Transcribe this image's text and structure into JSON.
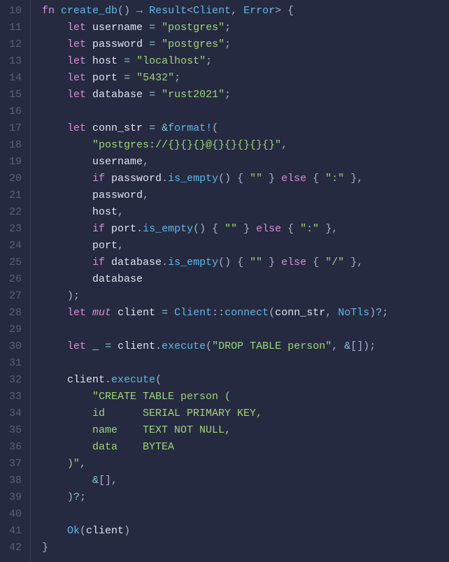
{
  "gutter": {
    "start": 10,
    "end": 42
  },
  "code": {
    "lines": [
      [
        [
          "kw",
          "fn "
        ],
        [
          "fn",
          "create_db"
        ],
        [
          "pun",
          "() "
        ],
        [
          "op",
          "→"
        ],
        [
          "pun",
          " "
        ],
        [
          "ty",
          "Result"
        ],
        [
          "pun",
          "<"
        ],
        [
          "ty",
          "Client"
        ],
        [
          "pun",
          ", "
        ],
        [
          "ty",
          "Error"
        ],
        [
          "pun",
          "> {"
        ]
      ],
      [
        [
          "pun",
          "    "
        ],
        [
          "kw",
          "let"
        ],
        [
          "pun",
          " "
        ],
        [
          "var",
          "username"
        ],
        [
          "pun",
          " "
        ],
        [
          "op",
          "="
        ],
        [
          "pun",
          " "
        ],
        [
          "str",
          "\"postgres\""
        ],
        [
          "pun",
          ";"
        ]
      ],
      [
        [
          "pun",
          "    "
        ],
        [
          "kw",
          "let"
        ],
        [
          "pun",
          " "
        ],
        [
          "var",
          "password"
        ],
        [
          "pun",
          " "
        ],
        [
          "op",
          "="
        ],
        [
          "pun",
          " "
        ],
        [
          "str",
          "\"postgres\""
        ],
        [
          "pun",
          ";"
        ]
      ],
      [
        [
          "pun",
          "    "
        ],
        [
          "kw",
          "let"
        ],
        [
          "pun",
          " "
        ],
        [
          "var",
          "host"
        ],
        [
          "pun",
          " "
        ],
        [
          "op",
          "="
        ],
        [
          "pun",
          " "
        ],
        [
          "str",
          "\"localhost\""
        ],
        [
          "pun",
          ";"
        ]
      ],
      [
        [
          "pun",
          "    "
        ],
        [
          "kw",
          "let"
        ],
        [
          "pun",
          " "
        ],
        [
          "var",
          "port"
        ],
        [
          "pun",
          " "
        ],
        [
          "op",
          "="
        ],
        [
          "pun",
          " "
        ],
        [
          "str",
          "\"5432\""
        ],
        [
          "pun",
          ";"
        ]
      ],
      [
        [
          "pun",
          "    "
        ],
        [
          "kw",
          "let"
        ],
        [
          "pun",
          " "
        ],
        [
          "var",
          "database"
        ],
        [
          "pun",
          " "
        ],
        [
          "op",
          "="
        ],
        [
          "pun",
          " "
        ],
        [
          "str",
          "\"rust2021\""
        ],
        [
          "pun",
          ";"
        ]
      ],
      [],
      [
        [
          "pun",
          "    "
        ],
        [
          "kw",
          "let"
        ],
        [
          "pun",
          " "
        ],
        [
          "var",
          "conn_str"
        ],
        [
          "pun",
          " "
        ],
        [
          "op",
          "="
        ],
        [
          "pun",
          " "
        ],
        [
          "amp",
          "&"
        ],
        [
          "mac",
          "format!"
        ],
        [
          "pun",
          "("
        ]
      ],
      [
        [
          "pun",
          "        "
        ],
        [
          "str",
          "\"postgres://{}{}{}@{}{}{}{}{}\""
        ],
        [
          "pun",
          ","
        ]
      ],
      [
        [
          "pun",
          "        "
        ],
        [
          "var",
          "username"
        ],
        [
          "pun",
          ","
        ]
      ],
      [
        [
          "pun",
          "        "
        ],
        [
          "kw",
          "if"
        ],
        [
          "pun",
          " "
        ],
        [
          "var",
          "password"
        ],
        [
          "pun",
          "."
        ],
        [
          "fn",
          "is_empty"
        ],
        [
          "pun",
          "() { "
        ],
        [
          "str",
          "\"\""
        ],
        [
          "pun",
          " } "
        ],
        [
          "kw",
          "else"
        ],
        [
          "pun",
          " { "
        ],
        [
          "str",
          "\":\""
        ],
        [
          "pun",
          " },"
        ]
      ],
      [
        [
          "pun",
          "        "
        ],
        [
          "var",
          "password"
        ],
        [
          "pun",
          ","
        ]
      ],
      [
        [
          "pun",
          "        "
        ],
        [
          "var",
          "host"
        ],
        [
          "pun",
          ","
        ]
      ],
      [
        [
          "pun",
          "        "
        ],
        [
          "kw",
          "if"
        ],
        [
          "pun",
          " "
        ],
        [
          "var",
          "port"
        ],
        [
          "pun",
          "."
        ],
        [
          "fn",
          "is_empty"
        ],
        [
          "pun",
          "() { "
        ],
        [
          "str",
          "\"\""
        ],
        [
          "pun",
          " } "
        ],
        [
          "kw",
          "else"
        ],
        [
          "pun",
          " { "
        ],
        [
          "str",
          "\":\""
        ],
        [
          "pun",
          " },"
        ]
      ],
      [
        [
          "pun",
          "        "
        ],
        [
          "var",
          "port"
        ],
        [
          "pun",
          ","
        ]
      ],
      [
        [
          "pun",
          "        "
        ],
        [
          "kw",
          "if"
        ],
        [
          "pun",
          " "
        ],
        [
          "var",
          "database"
        ],
        [
          "pun",
          "."
        ],
        [
          "fn",
          "is_empty"
        ],
        [
          "pun",
          "() { "
        ],
        [
          "str",
          "\"\""
        ],
        [
          "pun",
          " } "
        ],
        [
          "kw",
          "else"
        ],
        [
          "pun",
          " { "
        ],
        [
          "str",
          "\"/\""
        ],
        [
          "pun",
          " },"
        ]
      ],
      [
        [
          "pun",
          "        "
        ],
        [
          "var",
          "database"
        ]
      ],
      [
        [
          "pun",
          "    );"
        ]
      ],
      [
        [
          "pun",
          "    "
        ],
        [
          "kw",
          "let"
        ],
        [
          "pun",
          " "
        ],
        [
          "mut",
          "mut"
        ],
        [
          "pun",
          " "
        ],
        [
          "var",
          "client"
        ],
        [
          "pun",
          " "
        ],
        [
          "op",
          "="
        ],
        [
          "pun",
          " "
        ],
        [
          "ty",
          "Client"
        ],
        [
          "op",
          "::"
        ],
        [
          "fn",
          "connect"
        ],
        [
          "pun",
          "("
        ],
        [
          "var",
          "conn_str"
        ],
        [
          "pun",
          ", "
        ],
        [
          "ty",
          "NoTls"
        ],
        [
          "pun",
          ")"
        ],
        [
          "op",
          "?"
        ],
        [
          "pun",
          ";"
        ]
      ],
      [],
      [
        [
          "pun",
          "    "
        ],
        [
          "kw",
          "let"
        ],
        [
          "pun",
          " "
        ],
        [
          "var",
          "_"
        ],
        [
          "pun",
          " "
        ],
        [
          "op",
          "="
        ],
        [
          "pun",
          " "
        ],
        [
          "var",
          "client"
        ],
        [
          "pun",
          "."
        ],
        [
          "fn",
          "execute"
        ],
        [
          "pun",
          "("
        ],
        [
          "str",
          "\"DROP TABLE person\""
        ],
        [
          "pun",
          ", "
        ],
        [
          "amp",
          "&"
        ],
        [
          "pun",
          "[]);"
        ]
      ],
      [],
      [
        [
          "pun",
          "    "
        ],
        [
          "var",
          "client"
        ],
        [
          "pun",
          "."
        ],
        [
          "fn",
          "execute"
        ],
        [
          "pun",
          "("
        ]
      ],
      [
        [
          "pun",
          "        "
        ],
        [
          "str",
          "\"CREATE TABLE person ("
        ]
      ],
      [
        [
          "str",
          "        id      SERIAL PRIMARY KEY,"
        ]
      ],
      [
        [
          "str",
          "        name    TEXT NOT NULL,"
        ]
      ],
      [
        [
          "str",
          "        data    BYTEA"
        ]
      ],
      [
        [
          "str",
          "    )\""
        ],
        [
          "pun",
          ","
        ]
      ],
      [
        [
          "pun",
          "        "
        ],
        [
          "amp",
          "&"
        ],
        [
          "pun",
          "[],"
        ]
      ],
      [
        [
          "pun",
          "    )"
        ],
        [
          "op",
          "?"
        ],
        [
          "pun",
          ";"
        ]
      ],
      [],
      [
        [
          "pun",
          "    "
        ],
        [
          "ty",
          "Ok"
        ],
        [
          "pun",
          "("
        ],
        [
          "var",
          "client"
        ],
        [
          "pun",
          ")"
        ]
      ],
      [
        [
          "pun",
          "}"
        ]
      ]
    ]
  }
}
